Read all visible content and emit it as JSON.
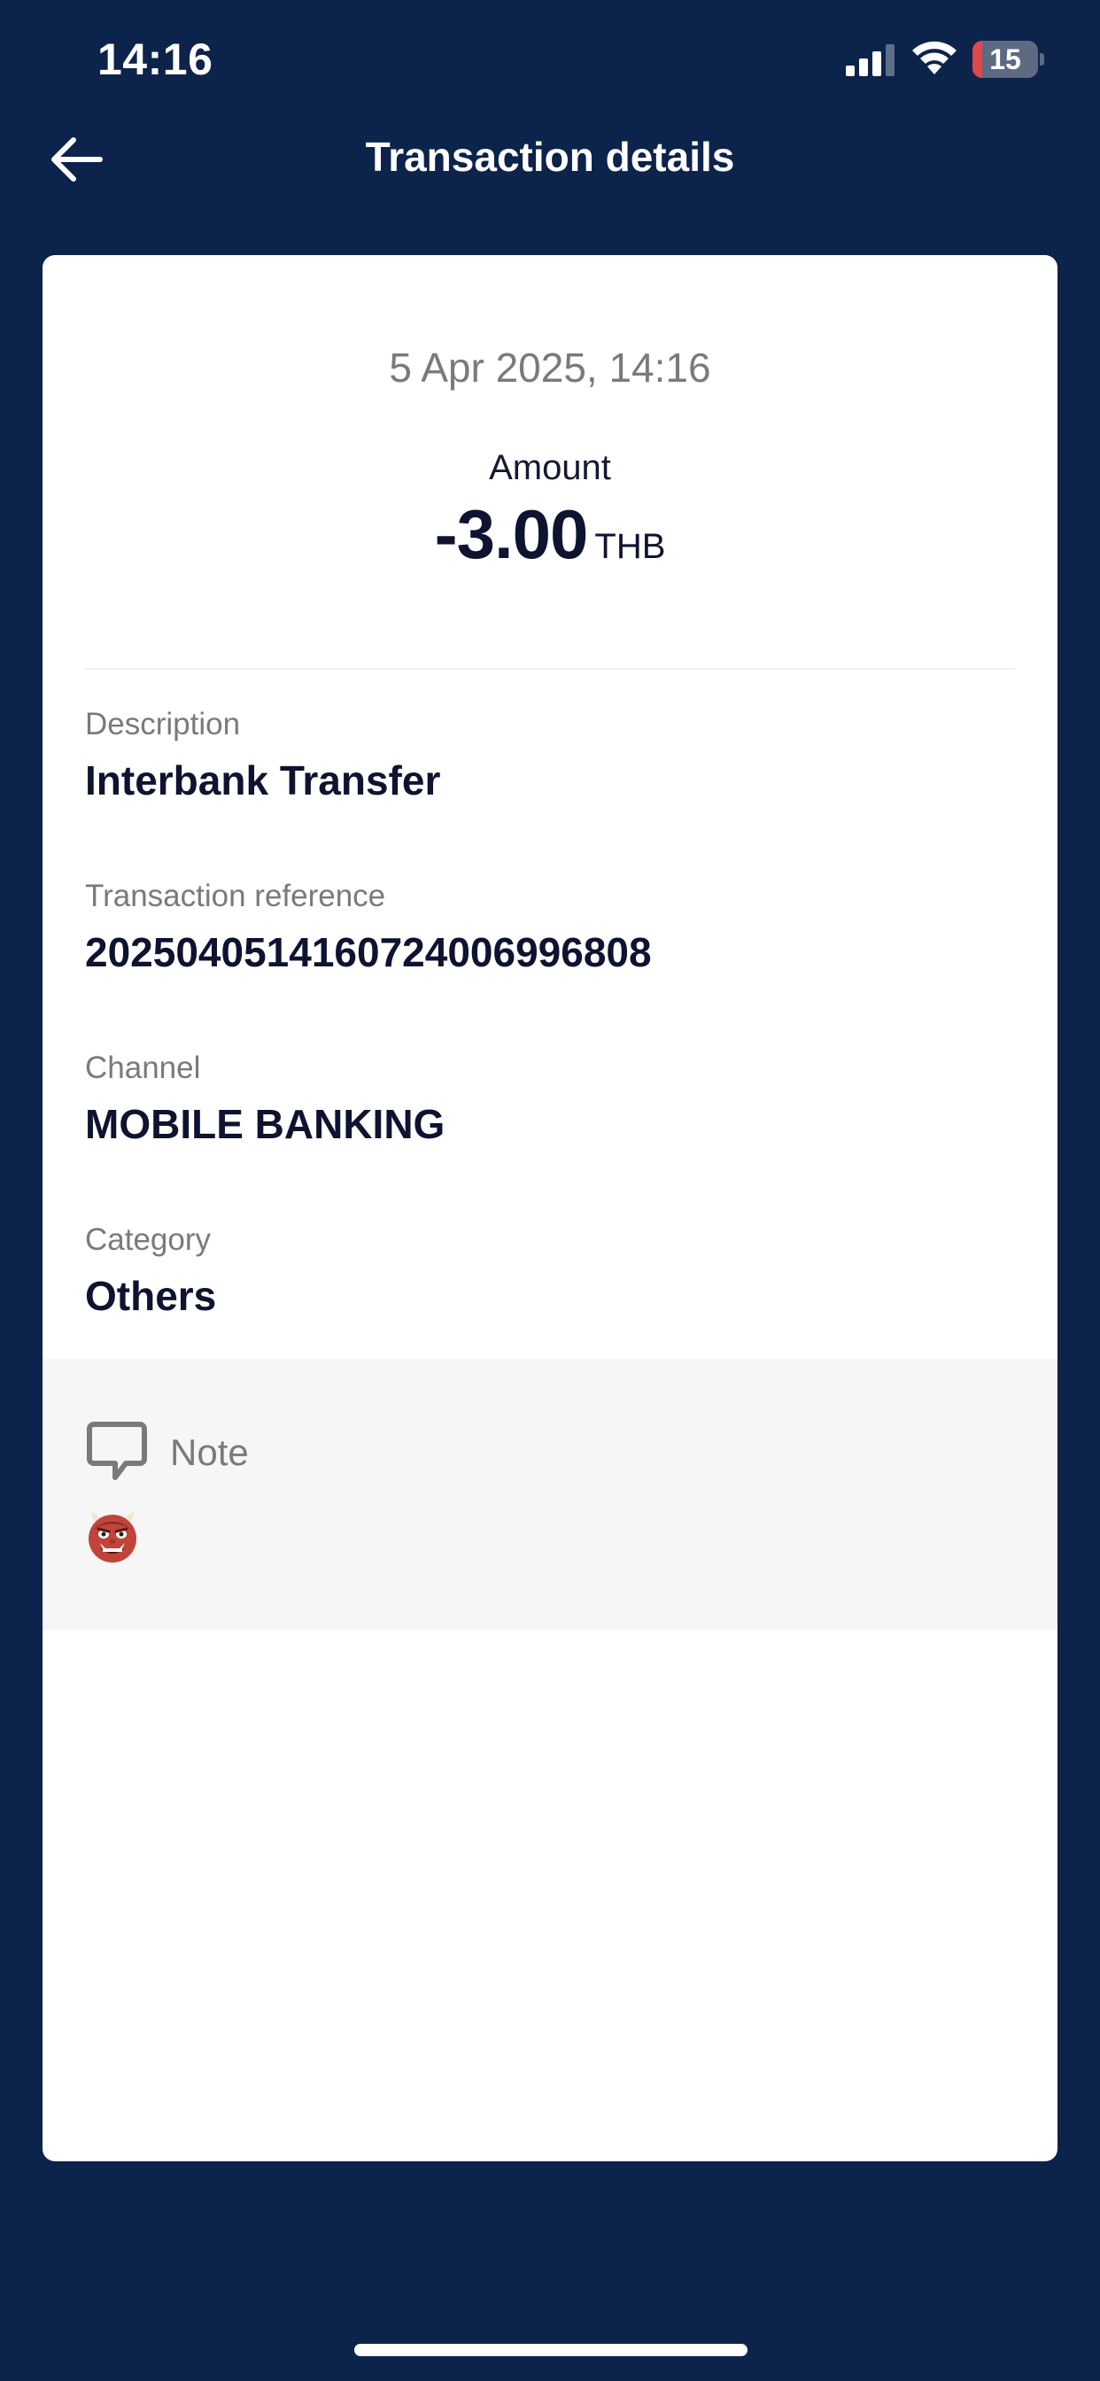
{
  "status_bar": {
    "time": "14:16",
    "battery_level": "15",
    "battery_fraction": 0.15,
    "signal_icon": "cellular-signal-icon",
    "wifi_icon": "wifi-icon"
  },
  "header": {
    "back_icon": "arrow-left-icon",
    "title": "Transaction details"
  },
  "transaction": {
    "date": "5 Apr 2025, 14:16",
    "amount_label": "Amount",
    "amount": "-3.00",
    "currency": "THB"
  },
  "fields": {
    "description_label": "Description",
    "description_value": "Interbank Transfer",
    "reference_label": "Transaction reference",
    "reference_value": "2025040514160724006996808",
    "channel_label": "Channel",
    "channel_value": "MOBILE BANKING",
    "category_label": "Category",
    "category_value": "Others"
  },
  "note": {
    "icon": "speech-bubble-icon",
    "label": "Note",
    "emoji_icon": "ogre-face-emoji"
  },
  "colors": {
    "background": "#0c234b",
    "card": "#ffffff",
    "note_background": "#f6f6f6",
    "primary_text": "#0d1330",
    "secondary_text": "#7a7a7a",
    "battery_low": "#e2474a"
  }
}
